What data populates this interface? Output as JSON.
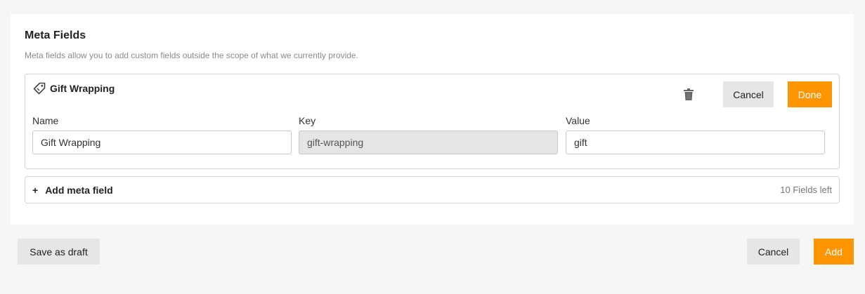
{
  "meta_fields": {
    "title": "Meta Fields",
    "description": "Meta fields allow you to add custom fields outside the scope of what we currently provide."
  },
  "field": {
    "title": "Gift Wrapping",
    "cancel_label": "Cancel",
    "done_label": "Done",
    "name_label": "Name",
    "name_value": "Gift Wrapping",
    "key_label": "Key",
    "key_value": "gift-wrapping",
    "value_label": "Value",
    "value_value": "gift",
    "icon": "tag-icon"
  },
  "add_field": {
    "label": "Add meta field",
    "remaining": "10 Fields left",
    "icon": "plus-icon"
  },
  "footer": {
    "draft_label": "Save as draft",
    "cancel_label": "Cancel",
    "add_label": "Add"
  },
  "colors": {
    "accent": "#ff9500",
    "background": "#f5f6f8",
    "secondary_button": "#e6e6e6"
  }
}
